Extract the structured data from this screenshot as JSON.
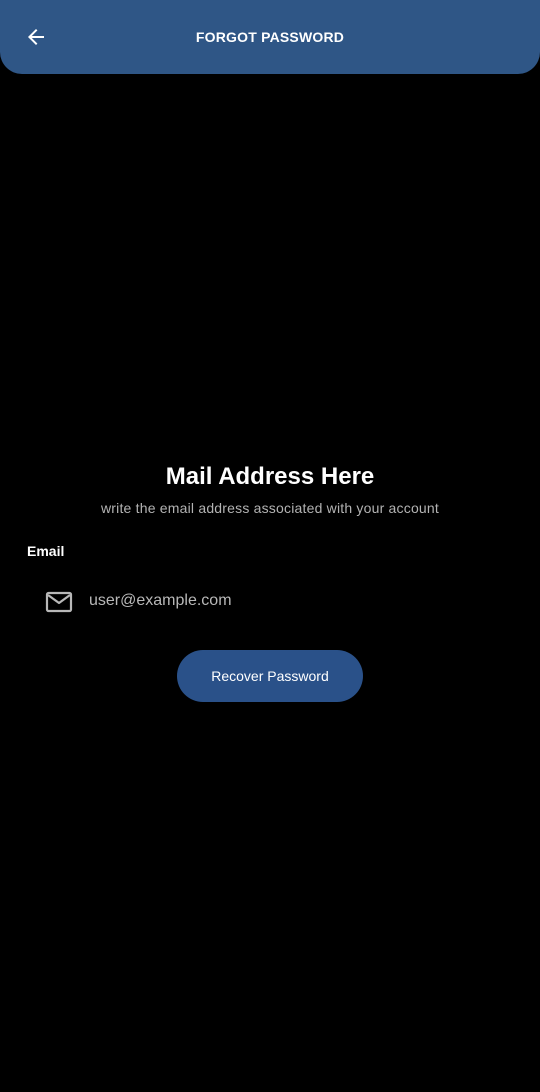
{
  "app_bar": {
    "title": "FORGOT PASSWORD",
    "back_icon": "arrow-left-icon",
    "color": "#2f5686"
  },
  "main": {
    "heading": "Mail Address Here",
    "subheading": "write the email address associated with your account",
    "email_field": {
      "label": "Email",
      "icon": "mail-icon",
      "placeholder": "user@example.com",
      "value": ""
    },
    "recover_button": {
      "label": "Recover Password",
      "color": "#2a5189"
    }
  },
  "colors": {
    "background": "#000000",
    "text_primary": "#ffffff",
    "text_secondary": "#b3b3b3"
  }
}
